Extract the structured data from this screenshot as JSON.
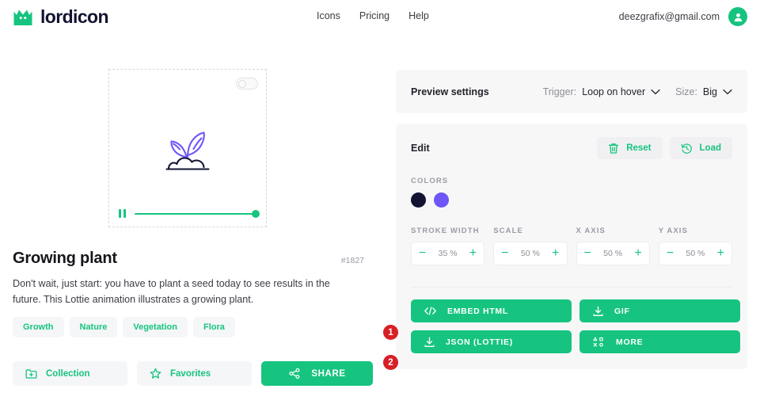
{
  "brand": {
    "name": "lordicon",
    "logo_icon": "crown-icon",
    "green": "#16c47f",
    "dark": "#121331",
    "purple": "#6e56f8",
    "red": "#d81f26"
  },
  "header": {
    "nav": [
      {
        "label": "Icons",
        "name": "nav-icons"
      },
      {
        "label": "Pricing",
        "name": "nav-pricing"
      },
      {
        "label": "Help",
        "name": "nav-help"
      }
    ],
    "account_email": "deezgrafix@gmail.com",
    "avatar_icon": "user-icon"
  },
  "preview": {
    "toggle_state": "off",
    "toggle_icon": "toggle-switch-icon",
    "animation_icon": "growing-plant-icon",
    "play_state_icon": "pause-icon",
    "progress_percent": 100
  },
  "details": {
    "title": "Growing plant",
    "icon_id": "#1827",
    "description": "Don't wait, just start: you have to plant a seed today to see results in the future. This Lottie animation illustrates a growing plant.",
    "tags": [
      "Growth",
      "Nature",
      "Vegetation",
      "Flora"
    ],
    "actions": [
      {
        "label": "Collection",
        "icon": "folder-plus-icon",
        "name": "collection-button"
      },
      {
        "label": "Favorites",
        "icon": "star-icon",
        "name": "favorites-button"
      },
      {
        "label": "SHARE",
        "icon": "share-icon",
        "name": "share-button"
      }
    ]
  },
  "preview_settings": {
    "title": "Preview settings",
    "trigger": {
      "label": "Trigger:",
      "value": "Loop on hover",
      "icon": "chevron-down-icon"
    },
    "size": {
      "label": "Size:",
      "value": "Big",
      "icon": "chevron-down-icon"
    }
  },
  "edit": {
    "title": "Edit",
    "reset": {
      "label": "Reset",
      "icon": "trash-icon"
    },
    "load": {
      "label": "Load",
      "icon": "history-icon"
    },
    "colors_label": "COLORS",
    "colors": [
      {
        "name": "primary-color-swatch",
        "hex": "#121331"
      },
      {
        "name": "secondary-color-swatch",
        "hex": "#6e56f8"
      }
    ],
    "steppers": [
      {
        "label": "STROKE WIDTH",
        "value": "35 %",
        "name": "stroke-width-stepper"
      },
      {
        "label": "SCALE",
        "value": "50 %",
        "name": "scale-stepper"
      },
      {
        "label": "X AXIS",
        "value": "50 %",
        "name": "x-axis-stepper"
      },
      {
        "label": "Y AXIS",
        "value": "50 %",
        "name": "y-axis-stepper"
      }
    ],
    "minus": "−",
    "plus": "+"
  },
  "downloads": [
    {
      "label": "EMBED HTML",
      "icon": "code-icon",
      "name": "embed-html-button"
    },
    {
      "label": "GIF",
      "icon": "download-icon",
      "name": "gif-button"
    },
    {
      "label": "JSON (LOTTIE)",
      "icon": "download-icon",
      "name": "json-lottie-button"
    },
    {
      "label": "MORE",
      "icon": "shapes-icon",
      "name": "more-button"
    }
  ],
  "annotations": [
    {
      "number": "1",
      "name": "annotation-badge-1"
    },
    {
      "number": "2",
      "name": "annotation-badge-2"
    }
  ]
}
